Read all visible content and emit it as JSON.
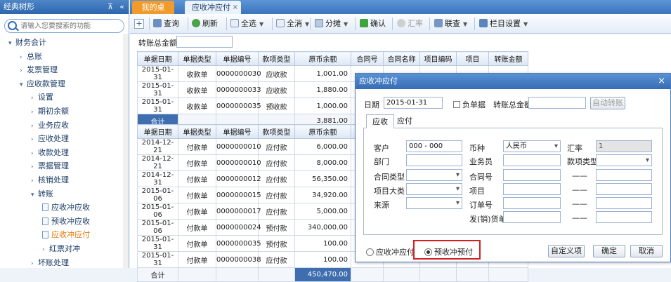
{
  "left": {
    "title": "经典树形",
    "pin": "⊼",
    "close": "«",
    "search_placeholder": "请输入您要搜索的功能",
    "tree": [
      {
        "label": "财务会计",
        "level": 0,
        "arrow": "▾"
      },
      {
        "label": "总账",
        "level": 1,
        "arrow": "›"
      },
      {
        "label": "发票管理",
        "level": 1,
        "arrow": "›"
      },
      {
        "label": "应收款管理",
        "level": 1,
        "arrow": "▾"
      },
      {
        "label": "设置",
        "level": 2,
        "arrow": "›"
      },
      {
        "label": "期初余额",
        "level": 2,
        "arrow": "›"
      },
      {
        "label": "业务应收",
        "level": 2,
        "arrow": "›"
      },
      {
        "label": "应收处理",
        "level": 2,
        "arrow": "›"
      },
      {
        "label": "收款处理",
        "level": 2,
        "arrow": "›"
      },
      {
        "label": "票据管理",
        "level": 2,
        "arrow": "›"
      },
      {
        "label": "核销处理",
        "level": 2,
        "arrow": "›"
      },
      {
        "label": "转账",
        "level": 2,
        "arrow": "▾"
      },
      {
        "label": "应收冲应收",
        "level": 3,
        "leaf": true
      },
      {
        "label": "预收冲应收",
        "level": 3,
        "leaf": true
      },
      {
        "label": "应收冲应付",
        "level": 3,
        "leaf": true,
        "selected": true
      },
      {
        "label": "红票对冲",
        "level": 3,
        "arrow": "›"
      },
      {
        "label": "坏账处理",
        "level": 2,
        "arrow": "›"
      }
    ]
  },
  "tabs": {
    "home": "我的桌面",
    "active": "应收冲应付",
    "close": "×"
  },
  "toolbar": {
    "query": "查询",
    "refresh": "刷新",
    "select_all": "全选",
    "deselect_all": "全消",
    "split": "分摊",
    "confirm": "确认",
    "rate": "汇率",
    "linked_query": "联查",
    "column_settings": "栏目设置"
  },
  "main": {
    "total_label": "转账总金额",
    "headers": [
      "单据日期",
      "单据类型",
      "单据编号",
      "款项类型",
      "原币余额",
      "合同号",
      "合同名称",
      "项目编码",
      "项目",
      "转账金额"
    ],
    "receipt_rows": [
      [
        "2015-01-31",
        "收款单",
        "0000000030",
        "应收款",
        "1,001.00"
      ],
      [
        "2015-01-31",
        "收款单",
        "0000000033",
        "应收款",
        "1,880.00"
      ],
      [
        "2015-01-31",
        "收款单",
        "0000000035",
        "预收款",
        "1,000.00"
      ]
    ],
    "receipt_sum": {
      "label": "合计",
      "amount": "3,881.00"
    },
    "payment_rows": [
      [
        "2014-12-21",
        "付款单",
        "0000000010",
        "应付款",
        "6,000.00"
      ],
      [
        "2014-12-21",
        "付款单",
        "0000000010",
        "应付款",
        "8,000.00"
      ],
      [
        "2014-12-31",
        "付款单",
        "0000000012",
        "应付款",
        "56,350.00"
      ],
      [
        "2015-01-06",
        "付款单",
        "0000000015",
        "应付款",
        "34,920.00"
      ],
      [
        "2015-01-06",
        "付款单",
        "0000000017",
        "应付款",
        "5,000.00"
      ],
      [
        "2015-01-06",
        "付款单",
        "0000000024",
        "预付款",
        "340,000.00"
      ],
      [
        "2015-01-31",
        "付款单",
        "0000000035",
        "预付款",
        "100.00"
      ],
      [
        "2015-01-31",
        "付款单",
        "0000000038",
        "应付款",
        "100.00"
      ]
    ],
    "payment_sum": {
      "label": "合计",
      "amount": "450,470.00"
    }
  },
  "dialog": {
    "title": "应收冲应付",
    "close": "×",
    "date_label": "日期",
    "date_value": "2015-01-31",
    "negative_label": "负单据",
    "total_label": "转账总金额",
    "auto_transfer": "自动转账",
    "tab_receivable": "应收",
    "tab_payable": "应付",
    "customer_label": "客户",
    "customer_value": "000 - 000",
    "currency_label": "币种",
    "currency_value": "人民币",
    "rate_label": "汇率",
    "rate_value": "1",
    "dept_label": "部门",
    "salesman_label": "业务员",
    "fund_type_label": "款项类型",
    "contract_type_label": "合同类型",
    "contract_no_label": "合同号",
    "project_class_label": "项目大类",
    "project_label": "项目",
    "source_label": "来源",
    "order_no_label": "订单号",
    "ship_label": "发(销)货单",
    "dash": "——",
    "radio_ar_ap": "应收冲应付",
    "radio_pre": "预收冲预付",
    "custom_btn": "自定义项",
    "ok_btn": "确定",
    "cancel_btn": "取消"
  }
}
